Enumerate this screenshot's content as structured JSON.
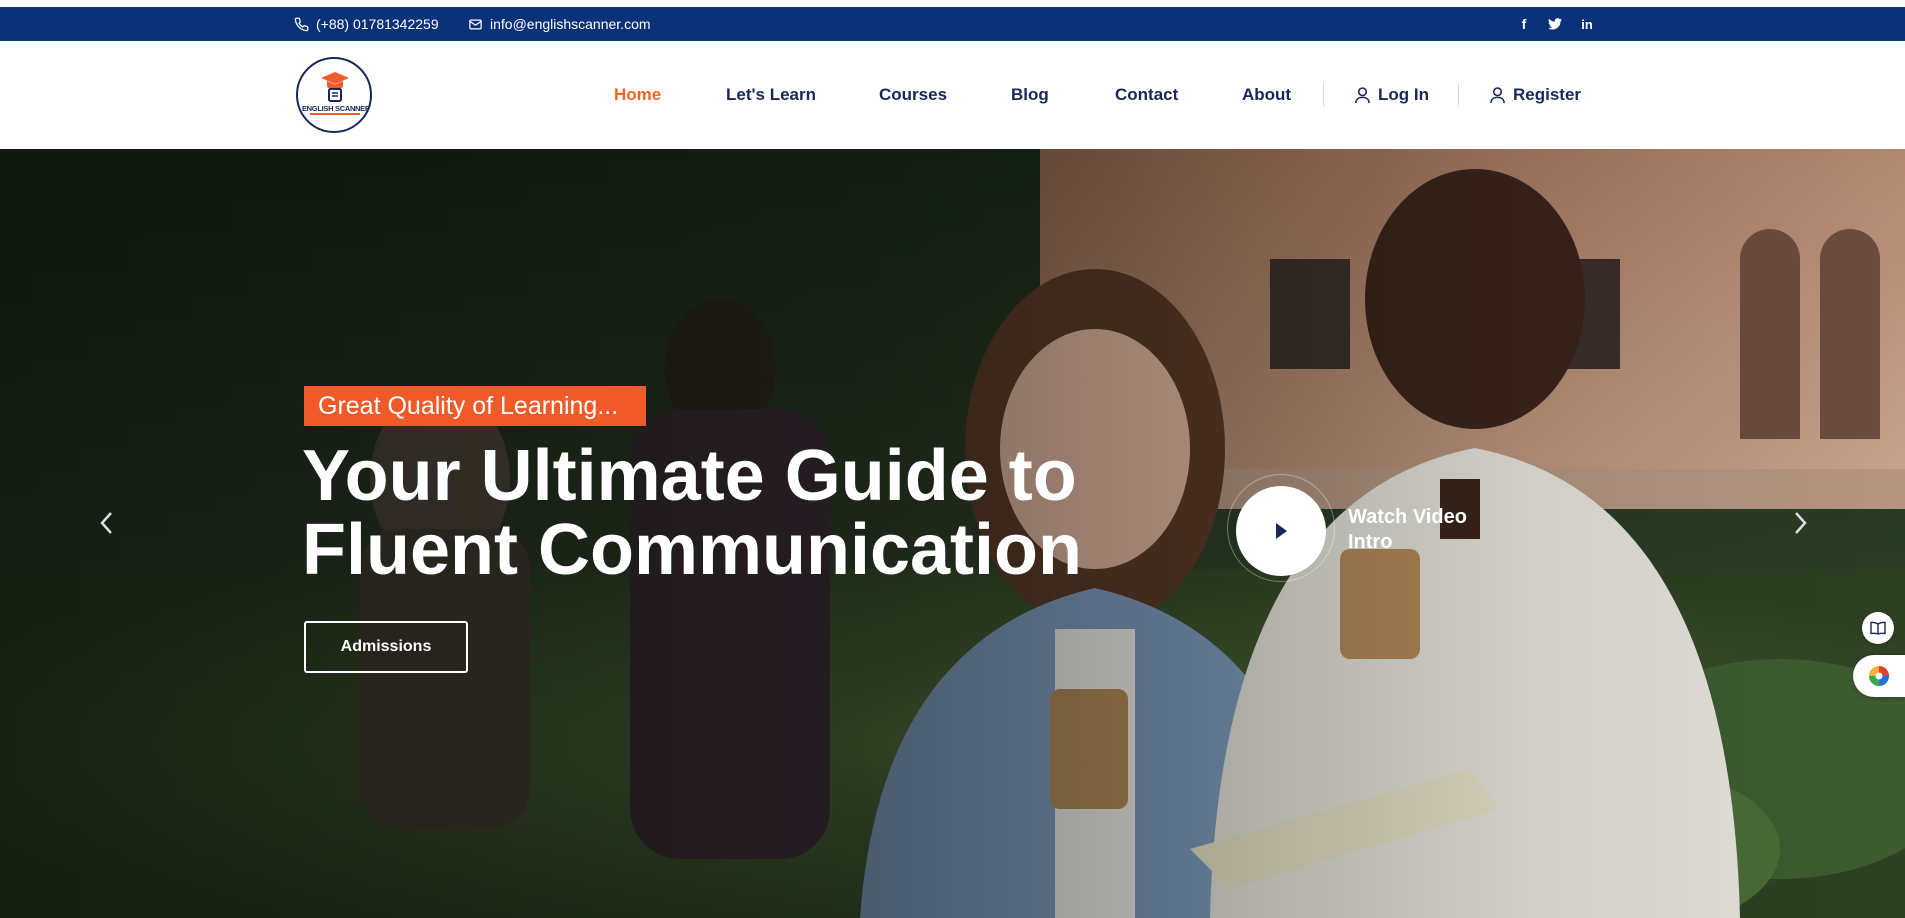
{
  "topbar": {
    "phone": "(+88) 01781342259",
    "email": "info@englishscanner.com",
    "social": [
      {
        "icon": "facebook-icon",
        "glyph": "f"
      },
      {
        "icon": "twitter-icon"
      },
      {
        "icon": "linkedin-icon",
        "glyph": "in"
      }
    ]
  },
  "logo": {
    "text": "ENGLISH SCANNER"
  },
  "nav": {
    "items": [
      "Home",
      "Let's Learn",
      "Courses",
      "Blog",
      "Contact",
      "About"
    ],
    "active": "Home",
    "login": "Log In",
    "register": "Register"
  },
  "hero": {
    "badge": "Great Quality of Learning...",
    "title_line1": "Your Ultimate Guide to",
    "title_line2": "Fluent Communication",
    "button": "Admissions",
    "video_line1": "Watch Video",
    "video_line2": "Intro"
  },
  "colors": {
    "topbar": "#0b3278",
    "nav_text": "#17285a",
    "accent": "#f05a28",
    "active_nav": "#f26522"
  }
}
